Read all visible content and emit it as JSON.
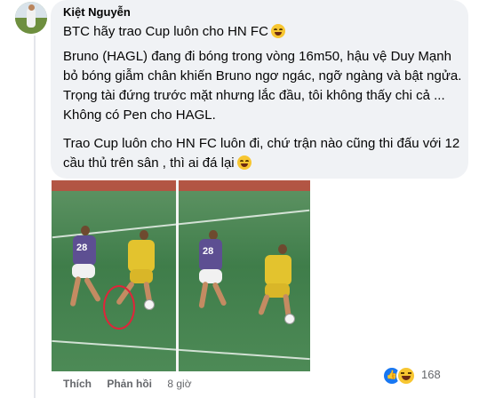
{
  "comment": {
    "author": "Kiệt Nguyễn",
    "paragraphs": [
      "BTC hãy trao Cup luôn cho HN FC",
      "Bruno (HAGL) đang đi bóng trong vòng 16m50, hậu vệ Duy Mạnh bỏ bóng giẫm chân khiến Bruno ngơ ngác, ngỡ ngàng và bật ngửa. Trọng tài đứng trước mặt nhưng lắc đầu, tôi không thấy chi cả ... Không có Pen cho HAGL.",
      "Trao Cup luôn cho HN FC luôn đi, chứ trận nào cũng thi đấu với 12 cầu thủ trên sân , thì ai đá lại"
    ],
    "emojis": [
      "grin-emoji",
      "laugh-emoji"
    ],
    "image": {
      "player_numbers": [
        "28",
        "28"
      ]
    },
    "actions": {
      "like": "Thích",
      "reply": "Phản hồi",
      "time": "8 giờ"
    },
    "reactions": {
      "icons": [
        "like-icon",
        "haha-icon"
      ],
      "count": "168"
    }
  },
  "colors": {
    "bubble": "#f0f2f5",
    "secondary_text": "#65676b",
    "like_blue": "#1877f2",
    "highlight_ring": "#e0243a"
  }
}
